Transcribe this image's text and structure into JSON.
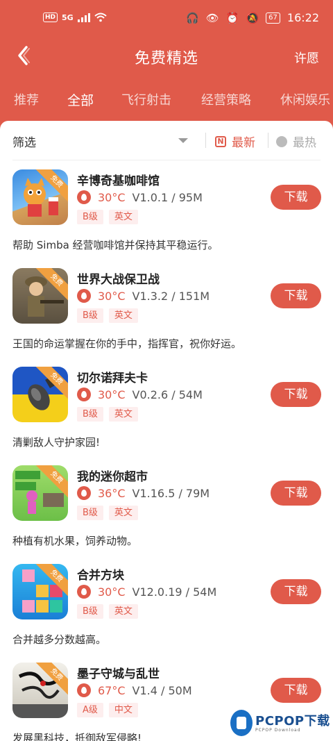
{
  "status": {
    "hd": "HD",
    "network": "5G",
    "time": "16:22",
    "battery": "67"
  },
  "nav": {
    "title": "免费精选",
    "wish": "许愿"
  },
  "tabs": [
    "推荐",
    "全部",
    "飞行射击",
    "经营策略",
    "休闲娱乐"
  ],
  "active_tab": "全部",
  "filter": {
    "label": "筛选",
    "sort_new": "最新",
    "sort_new_icon": "N",
    "sort_hot": "最热"
  },
  "badge": "免费",
  "download_label": "下载",
  "apps": [
    {
      "name": "辛博奇基咖啡馆",
      "temp": "30°C",
      "info": "V1.0.1 / 95M",
      "tags": [
        "B级",
        "英文"
      ],
      "desc": "帮助 Simba 经营咖啡馆并保持其平稳运行。",
      "icon": "cafe-game-icon"
    },
    {
      "name": "世界大战保卫战",
      "temp": "30°C",
      "info": "V1.3.2 / 151M",
      "tags": [
        "B级",
        "英文"
      ],
      "desc": "王国的命运掌握在你的手中，指挥官，祝你好运。",
      "icon": "soldier-game-icon"
    },
    {
      "name": "切尔诺拜夫卡",
      "temp": "30°C",
      "info": "V0.2.6 / 54M",
      "tags": [
        "B级",
        "英文"
      ],
      "desc": "清剿敌人守护家园!",
      "icon": "bomb-game-icon"
    },
    {
      "name": "我的迷你超市",
      "temp": "36°C",
      "info": "V1.16.5 / 79M",
      "tags": [
        "B级",
        "英文"
      ],
      "desc": "种植有机水果，饲养动物。",
      "icon": "market-game-icon"
    },
    {
      "name": "合并方块",
      "temp": "30°C",
      "info": "V12.0.19 / 54M",
      "tags": [
        "B级",
        "英文"
      ],
      "desc": "合并越多分数越高。",
      "icon": "blocks-game-icon"
    },
    {
      "name": "墨子守城与乱世",
      "temp": "67°C",
      "info": "V1.4 / 50M",
      "tags": [
        "A级",
        "中文"
      ],
      "desc": "发展黑科技，抵御敌军侵略!",
      "icon": "ink-war-game-icon"
    }
  ],
  "watermark": {
    "text": "PCPOP下载",
    "sub": "PCPOP Download"
  }
}
